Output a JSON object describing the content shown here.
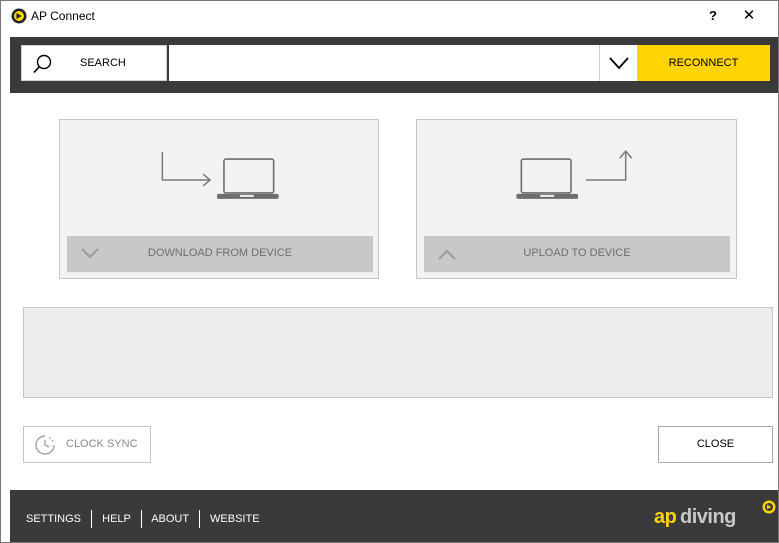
{
  "window": {
    "title": "AP Connect",
    "help_label": "?",
    "close_label": "✕"
  },
  "toolbar": {
    "search_label": "SEARCH",
    "device_value": "",
    "reconnect_label": "RECONNECT",
    "accent_color": "#ffd400",
    "background_color": "#3a3a3a"
  },
  "actions": {
    "download_label": "DOWNLOAD FROM DEVICE",
    "upload_label": "UPLOAD TO DEVICE"
  },
  "status": {
    "text": ""
  },
  "buttons": {
    "clock_sync_label": "CLOCK SYNC",
    "close_label": "CLOSE"
  },
  "footer": {
    "links": [
      "SETTINGS",
      "HELP",
      "ABOUT",
      "WEBSITE"
    ],
    "logo_ap": "ap",
    "logo_diving": "diving"
  },
  "icons": {
    "search": "search-icon",
    "dropdown": "chevron-down-icon",
    "download": "download-laptop-icon",
    "upload": "upload-laptop-icon",
    "clock": "clock-icon",
    "app": "ap-logo-icon"
  }
}
